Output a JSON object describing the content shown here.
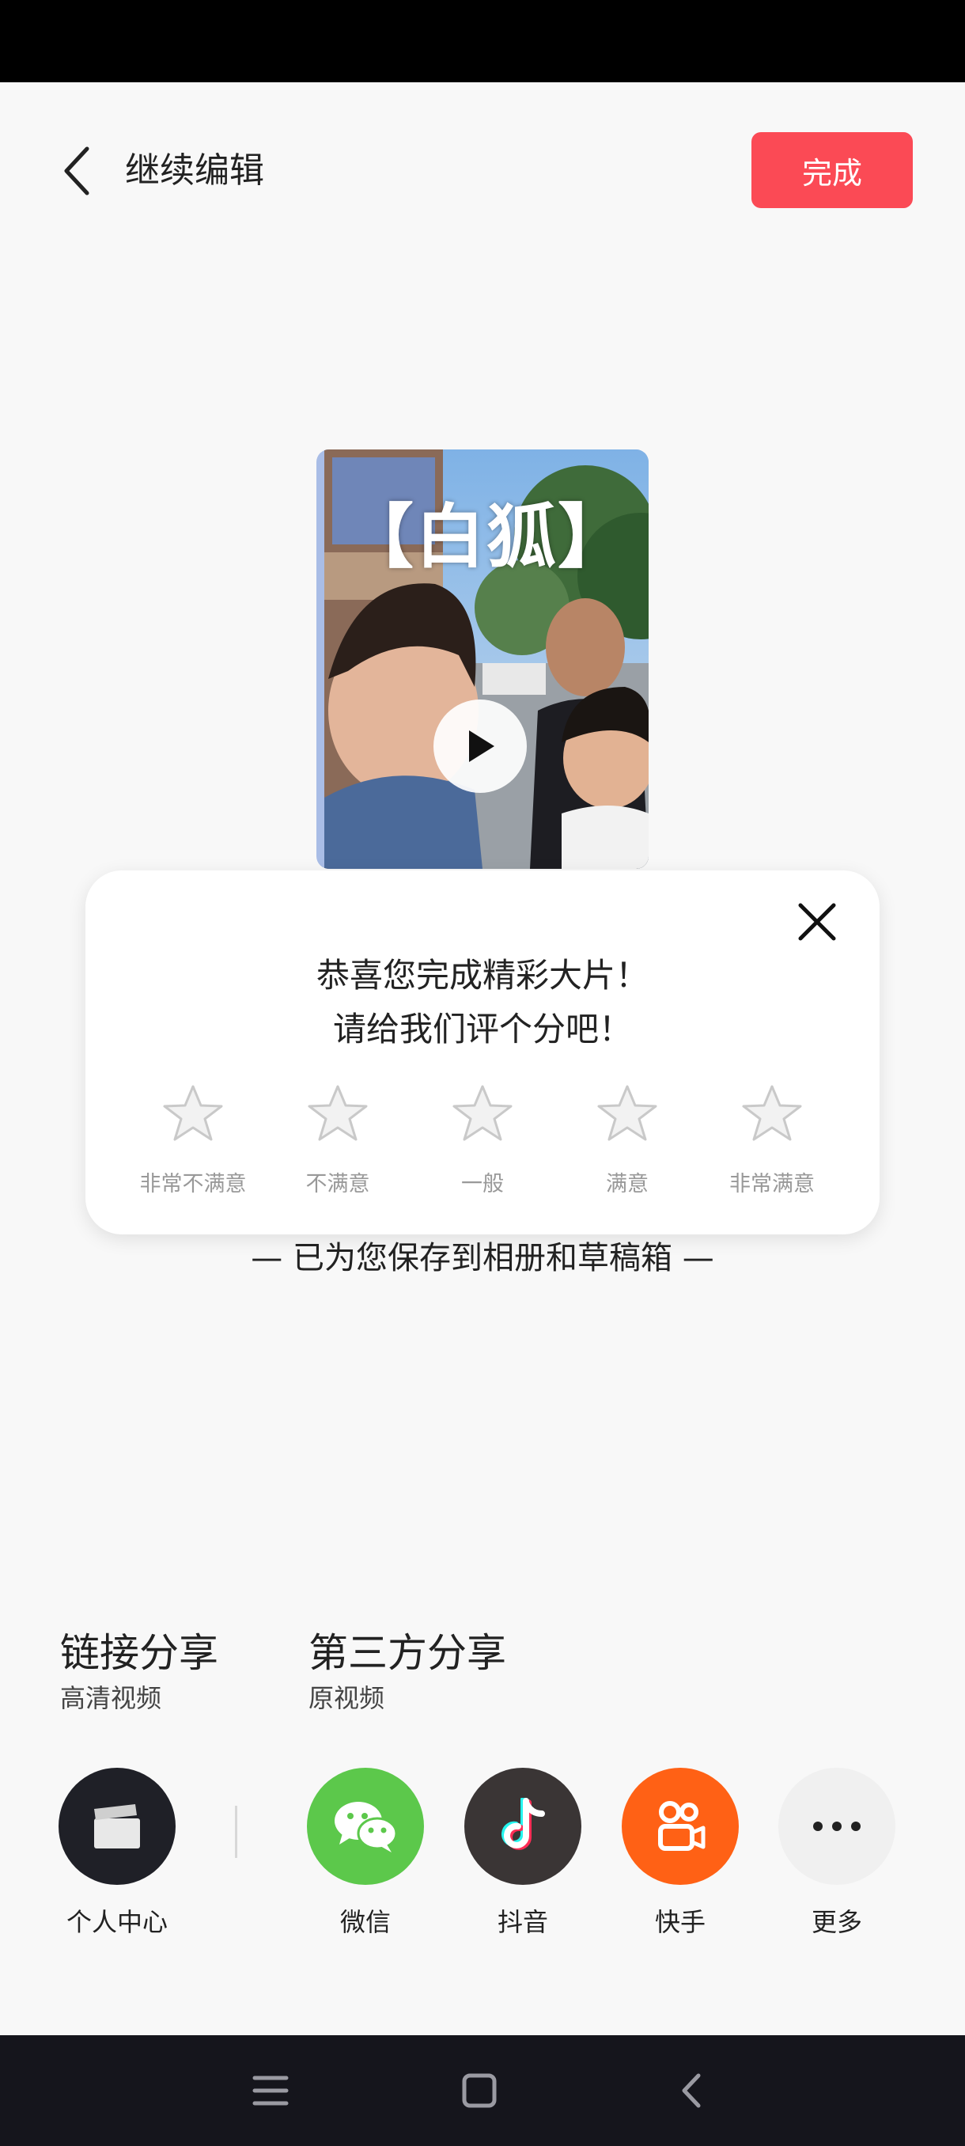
{
  "header": {
    "title": "继续编辑",
    "done_label": "完成"
  },
  "video": {
    "overlay_title": "【白狐】"
  },
  "rating": {
    "line1": "恭喜您完成精彩大片！",
    "line2": "请给我们评个分吧！",
    "options": [
      "非常不满意",
      "不满意",
      "一般",
      "满意",
      "非常满意"
    ]
  },
  "saved_message": "— 已为您保存到相册和草稿箱 —",
  "share": {
    "link_title": "链接分享",
    "link_sub": "高清视频",
    "third_title": "第三方分享",
    "third_sub": "原视频",
    "targets": [
      {
        "label": "个人中心",
        "icon": "clapperboard-icon",
        "color": "#1f2027"
      },
      {
        "label": "微信",
        "icon": "wechat-icon",
        "color": "#5cc84b"
      },
      {
        "label": "抖音",
        "icon": "tiktok-icon",
        "color": "#3a3535"
      },
      {
        "label": "快手",
        "icon": "kuaishou-icon",
        "color": "#ff6115"
      },
      {
        "label": "更多",
        "icon": "more-icon",
        "color": "#f0f0f0"
      }
    ]
  },
  "nav": {
    "icons": [
      "menu-icon",
      "home-icon",
      "back-icon"
    ]
  },
  "colors": {
    "accent": "#fb4a55",
    "background": "#f8f8f8"
  }
}
